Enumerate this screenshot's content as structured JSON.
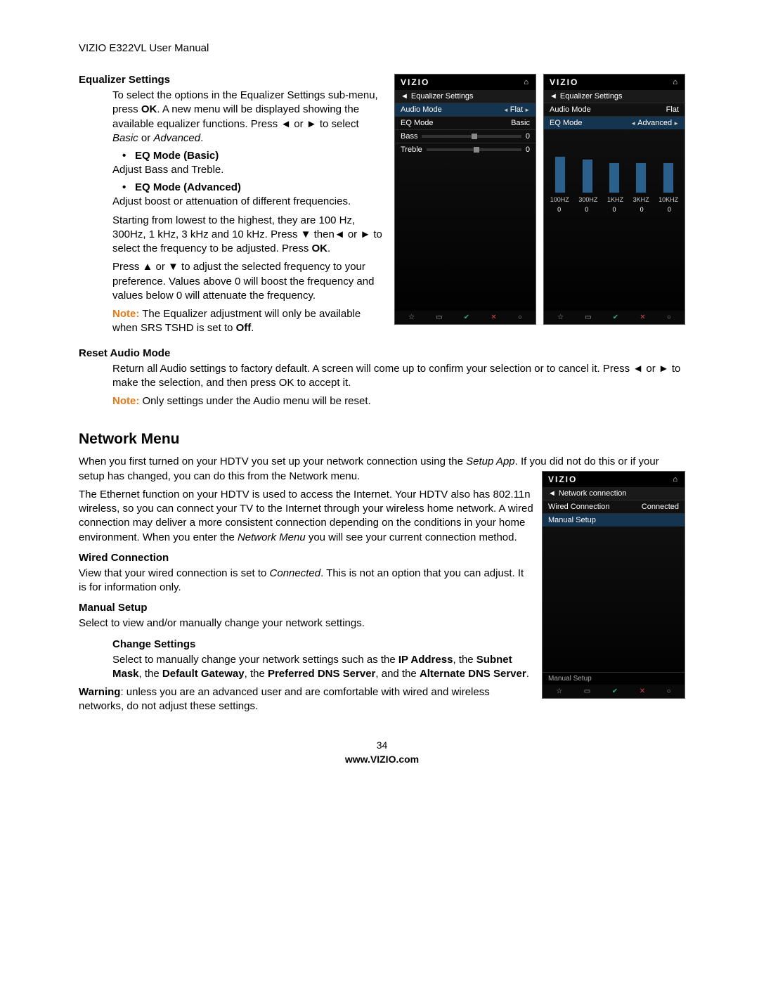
{
  "header": {
    "title": "VIZIO E322VL User Manual"
  },
  "eq": {
    "heading": "Equalizer Settings",
    "intro1": "To select the options in the Equalizer Settings sub-menu, press ",
    "intro_ok": "OK",
    "intro2": ". A new menu will be displayed showing the available equalizer functions. Press ◄ or ► to select ",
    "intro_basic": "Basic",
    "intro_or": " or ",
    "intro_adv": "Advanced",
    "intro_end": ".",
    "basic_h": "EQ Mode (Basic)",
    "basic_p": "Adjust Bass and Treble.",
    "adv_h": "EQ Mode (Advanced)",
    "adv_p1": "Adjust boost or attenuation of different frequencies.",
    "adv_p2a": "Starting from lowest to the highest, they are 100 Hz, 300Hz, 1 kHz, 3 kHz and 10 kHz. Press ▼ then◄ or ► to select the frequency to be adjusted. Press ",
    "adv_p2_ok": "OK",
    "adv_p2b": ".",
    "adv_p3": "Press ▲ or ▼ to adjust the selected frequency to your preference. Values above 0 will boost the frequency and values below 0 will attenuate the frequency.",
    "note_label": "Note:",
    "note_text": " The Equalizer adjustment will only be available when SRS TSHD is set to ",
    "note_off": "Off",
    "note_end": "."
  },
  "reset": {
    "heading": "Reset Audio Mode",
    "p": "Return all Audio settings to factory default. A screen will come up to confirm your selection or to cancel it. Press ◄ or ► to make the selection, and then press OK to accept it.",
    "note_label": "Note:",
    "note_text": " Only settings under the Audio menu will be reset."
  },
  "network": {
    "heading": "Network Menu",
    "p1a": "When you first turned on your HDTV you set up your network connection using the ",
    "p1_setup": "Setup App",
    "p1b": ". If you did not do this or if your setup has changed, you can do this from the Network menu.",
    "p2": "The Ethernet function on your HDTV is used to access the Internet. Your HDTV also has 802.11n wireless, so you can connect your TV to the Internet through your wireless home network. A wired connection may deliver a more consistent connection depending on the conditions in your home environment. When you enter the ",
    "p2_menu": "Network Menu",
    "p2b": " you will see your current connection method.",
    "wired_h": "Wired Connection",
    "wired_pa": "View that your wired connection is set to ",
    "wired_conn": "Connected",
    "wired_pb": ". This is not an option that you can adjust. It is for information only.",
    "manual_h": "Manual Setup",
    "manual_p": "Select to view and/or manually change your network settings.",
    "change_h": "Change Settings",
    "change_pa": "Select to manually change your network settings such as the ",
    "ip": "IP Address",
    "c2": ", the ",
    "subnet": "Subnet Mask",
    "c3": ", the ",
    "gateway": "Default Gateway",
    "c4": ", the ",
    "pdns": "Preferred DNS Server",
    "c5": ", and the ",
    "adns": "Alternate DNS Server",
    "c6": ".",
    "warn_label": "Warning",
    "warn_text": ": unless you are an advanced user and are comfortable with wired and wireless networks, do not adjust these settings."
  },
  "screen_basic": {
    "brand": "VIZIO",
    "title": "Equalizer Settings",
    "rows": {
      "audio_mode": {
        "label": "Audio Mode",
        "value": "Flat"
      },
      "eq_mode": {
        "label": "EQ Mode",
        "value": "Basic"
      },
      "bass": {
        "label": "Bass",
        "value": "0"
      },
      "treble": {
        "label": "Treble",
        "value": "0"
      }
    }
  },
  "screen_adv": {
    "brand": "VIZIO",
    "title": "Equalizer Settings",
    "rows": {
      "audio_mode": {
        "label": "Audio Mode",
        "value": "Flat"
      },
      "eq_mode": {
        "label": "EQ Mode",
        "value": "Advanced"
      }
    },
    "freq_labels": [
      "100HZ",
      "300HZ",
      "1KHZ",
      "3KHZ",
      "10KHZ"
    ],
    "freq_values": [
      "0",
      "0",
      "0",
      "0",
      "0"
    ]
  },
  "screen_net": {
    "brand": "VIZIO",
    "title": "Network connection",
    "rows": {
      "wired": {
        "label": "Wired Connection",
        "value": "Connected"
      },
      "manual": {
        "label": "Manual Setup"
      },
      "manual2": {
        "label": "Manual Setup"
      }
    }
  },
  "footer": {
    "page": "34",
    "site": "www.VIZIO.com"
  }
}
